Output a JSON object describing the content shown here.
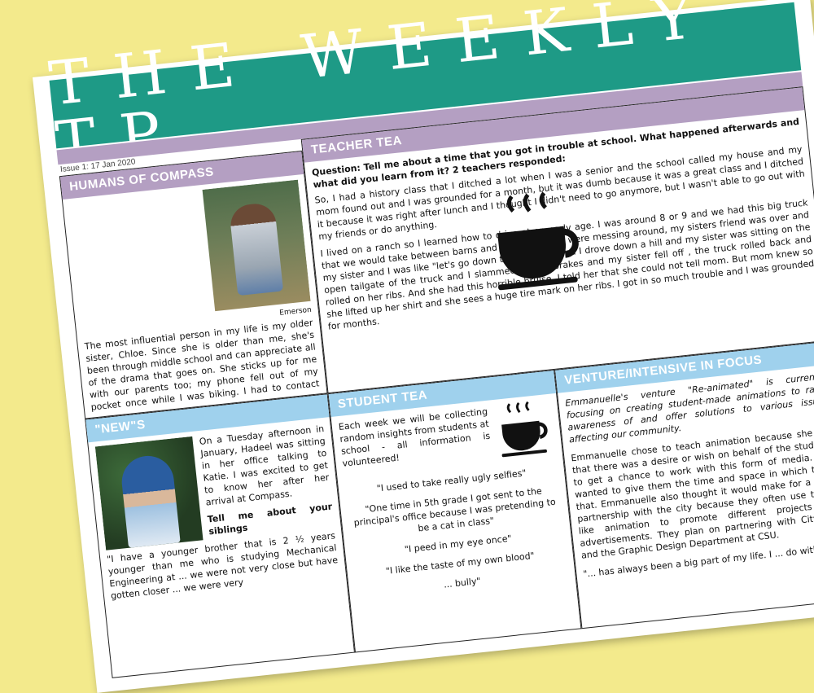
{
  "masthead": {
    "title": "THE WEEKLY TP",
    "issue": "Issue 1: 17 Jan 2020"
  },
  "humans": {
    "heading": "HUMANS OF COMPASS",
    "caption": "Emerson",
    "text": "The most influential person in my life is my older sister, Chloe. Since she is older than me, she's been through middle school and can appreciate all of the drama that goes on. She sticks up for me with our parents too; my phone fell out of my pocket once while I was biking. I had to contact my parents somehow - they were disappointed and worried when they found out that my phone was lost but Chloe supported me through it and talked to my parents, trying to calm them down. She is so young and already incredible."
  },
  "teacher_tea": {
    "heading": "TEACHER TEA",
    "question": "Question: Tell me about a time that you got in trouble at school. What happened afterwards and what did you learn from it? 2 teachers responded:",
    "p1": "So, I had a history class that I ditched a lot when I was a senior and the school called my house and my mom found out and I was grounded for a month, but it was dumb because it was a great class and I ditched it because it was right after lunch and I thought I didn't need to go anymore, but I wasn't able to go out with my friends or do anything.",
    "p2": "I lived on a ranch so I learned how to drive at an early age. I was around 8 or 9 and we had this big truck that we would take between barns and the house. We were messing around, my sisters friend was over and my sister and I was like \"let's go down to the pond\" and I drove down a hill and my sister was sitting on the open tailgate of the truck and I slammed on the brakes and my sister fell off , the truck rolled back and rolled on her ribs. And she had this horrible bruise, I told her that she could not tell mom. But mom knew so she lifted up her shirt and she sees a huge tire mark on her ribs. I got in so much trouble and I was grounded for months."
  },
  "news": {
    "heading": "\"NEW\"S",
    "intro": "On a Tuesday afternoon in January, Hadeel was sitting in her office talking to Katie. I was excited to get to know her after her arrival at Compass.",
    "subhead": "Tell me about your siblings",
    "quote": "\"I have a younger brother that is 2 ½ years younger than me who is studying Mechanical Engineering at ... we were not very close but have gotten closer ... we were very"
  },
  "student_tea": {
    "heading": "STUDENT TEA",
    "intro": "Each week we will be collecting random insights from students at school - all information is volunteered!",
    "quotes": [
      "\"I used to take really ugly selfies\"",
      "\"One time in 5th grade I got sent to the principal's office because I was pretending to be a cat in class\"",
      "\"I peed in my eye once\"",
      "\"I like the taste of my own blood\"",
      "... bully\""
    ]
  },
  "venture": {
    "heading": "VENTURE/INTENSIVE IN FOCUS",
    "lede": "Emmanuelle's venture \"Re-animated\" is currently focusing on creating student-made animations to raise awareness of and offer solutions to various issues affecting our community.",
    "p1": "Emmanuelle chose to teach animation because she felt that there was a desire or wish on behalf of the students to get a chance to work with this form of media. She wanted to give them the time and space in which to do that. Emmanuelle also thought it would make for a good partnership with the city because they often use things like animation to promote different projects and advertisements. They plan on partnering with City Hall and the Graphic Design Department at CSU.",
    "p2": "\"... has always been a big part of my life. I ... do with a lot"
  },
  "icons": {
    "cup": "coffee-cup-icon"
  }
}
